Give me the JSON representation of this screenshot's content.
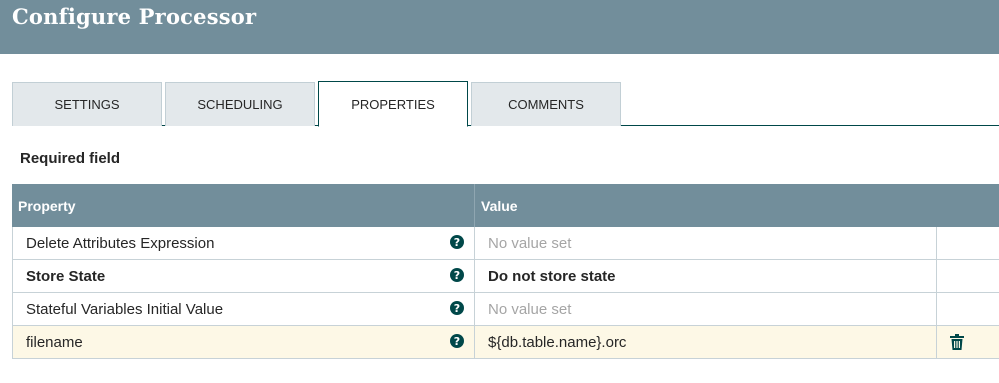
{
  "header": {
    "title": "Configure Processor"
  },
  "tabs": [
    {
      "label": "SETTINGS"
    },
    {
      "label": "SCHEDULING"
    },
    {
      "label": "PROPERTIES"
    },
    {
      "label": "COMMENTS"
    }
  ],
  "active_tab": "PROPERTIES",
  "required_label": "Required field",
  "table": {
    "headers": {
      "property": "Property",
      "value": "Value"
    },
    "rows": [
      {
        "property": "Delete Attributes Expression",
        "value": "No value set",
        "required": false,
        "is_placeholder": true,
        "help_icon": "question-circle-icon"
      },
      {
        "property": "Store State",
        "value": "Do not store state",
        "required": true,
        "is_placeholder": false,
        "help_icon": "question-circle-icon"
      },
      {
        "property": "Stateful Variables Initial Value",
        "value": "No value set",
        "required": false,
        "is_placeholder": true,
        "help_icon": "question-circle-icon"
      },
      {
        "property": "filename",
        "value": "${db.table.name}.orc",
        "required": false,
        "is_placeholder": false,
        "help_icon": "question-circle-icon",
        "highlighted": true,
        "action_icon": "trash-icon"
      }
    ]
  },
  "colors": {
    "header_bg": "#728e9b",
    "accent": "#004849",
    "highlight_row": "#fdf8e6"
  }
}
